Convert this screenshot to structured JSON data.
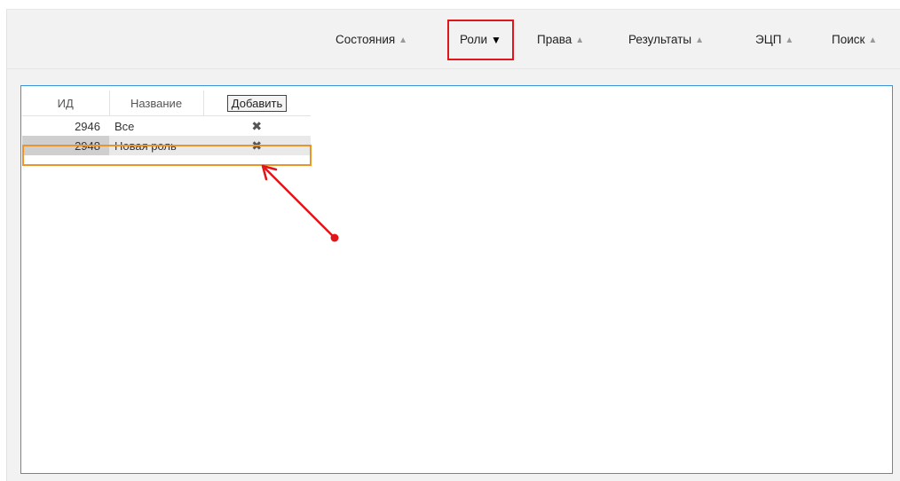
{
  "tabs": [
    {
      "label": "Состояния",
      "state": "collapsed"
    },
    {
      "label": "Роли",
      "state": "expanded"
    },
    {
      "label": "Права",
      "state": "collapsed"
    },
    {
      "label": "Результаты",
      "state": "collapsed"
    },
    {
      "label": "ЭЦП",
      "state": "collapsed"
    },
    {
      "label": "Поиск",
      "state": "collapsed"
    }
  ],
  "icons": {
    "collapsed": "chevron-up-icon",
    "expanded": "chevron-down-icon",
    "delete": "close-x-icon"
  },
  "table": {
    "headers": {
      "id": "ИД",
      "name": "Название",
      "add_button": "Добавить"
    },
    "rows": [
      {
        "id": "2946",
        "name": "Все",
        "selected": false
      },
      {
        "id": "2948",
        "name": "Новая роль",
        "selected": true
      }
    ]
  },
  "colors": {
    "active_tab_highlight": "#e0161b",
    "panel_border": "#3a95d8",
    "selected_row_outline": "#e8962a",
    "annotation_arrow": "#e0161b"
  }
}
